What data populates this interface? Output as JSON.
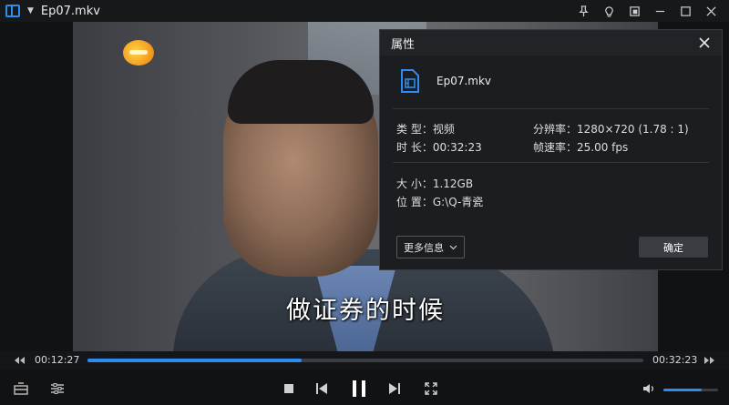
{
  "window": {
    "title": "Ep07.mkv"
  },
  "video": {
    "subtitle": "做证券的时候"
  },
  "properties_dialog": {
    "title": "属性",
    "file_name": "Ep07.mkv",
    "type": "类 型：视频",
    "resolution": "分辨率：1280×720 (1.78 : 1)",
    "duration": "时 长：00:32:23",
    "frame_rate": "帧速率：25.00 fps",
    "size": "大 小：1.12GB",
    "location": "位 置：G:\\Q-青瓷",
    "more_info_label": "更多信息",
    "ok_label": "确定"
  },
  "playback": {
    "current_time": "00:12:27",
    "total_time": "00:32:23",
    "progress_fraction": 0.385,
    "volume_fraction": 0.7
  },
  "colors": {
    "accent": "#2d8cf0",
    "background": "#111214",
    "dialog_bg": "#1c1d20"
  },
  "icons": {
    "app": "app-logo-icon",
    "pin": "pin-icon",
    "skin": "skin-icon",
    "miniplayer": "miniplayer-icon",
    "minimize": "minimize-icon",
    "maximize": "maximize-icon",
    "close": "close-icon",
    "file": "video-file-icon",
    "rewind": "rewind-icon",
    "forward": "forward-icon",
    "playlist": "playlist-icon",
    "settings": "equalizer-icon",
    "stop": "stop-icon",
    "previous": "previous-icon",
    "pause": "pause-icon",
    "next": "next-icon",
    "fullscreen": "fullscreen-icon",
    "volume": "volume-icon"
  }
}
